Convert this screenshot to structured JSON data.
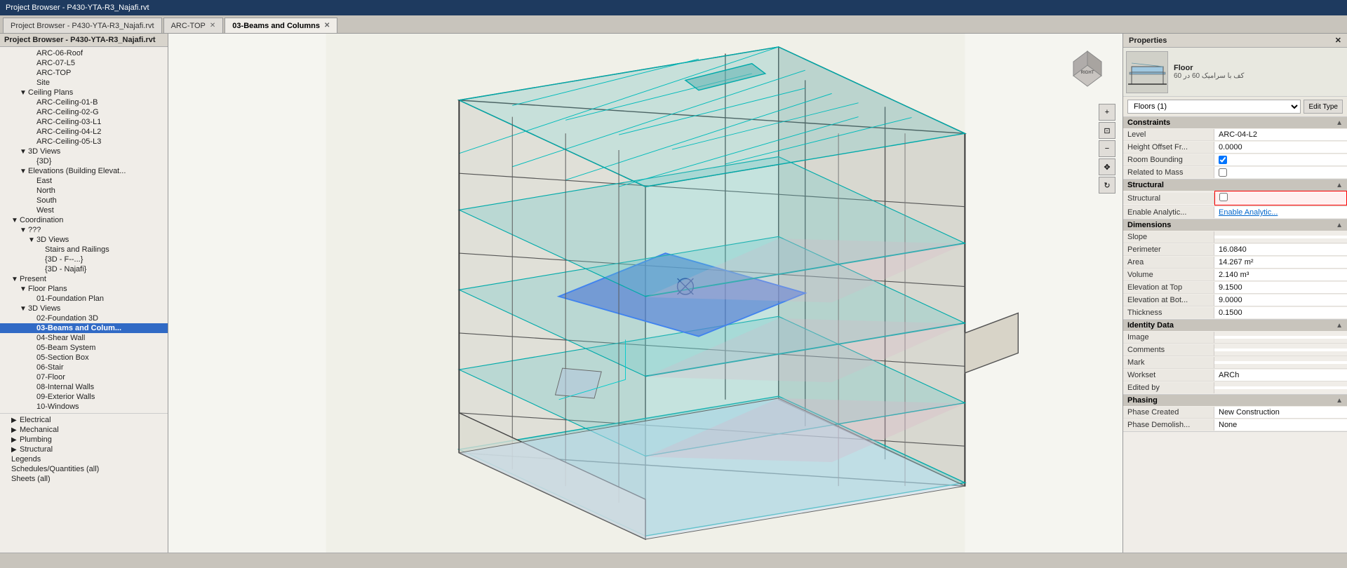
{
  "titleBar": {
    "text": "Project Browser - P430-YTA-R3_Najafi.rvt"
  },
  "tabs": [
    {
      "id": "project-browser",
      "label": "Project Browser - P430-YTA-R3_Najafi.rvt",
      "active": false,
      "closable": false
    },
    {
      "id": "arc-top",
      "label": "ARC-TOP",
      "active": false,
      "closable": true
    },
    {
      "id": "beams-columns",
      "label": "03-Beams and Columns",
      "active": true,
      "closable": true
    }
  ],
  "projectBrowser": {
    "title": "Project Browser - P430-YTA-R3_Najafi.rvt",
    "tree": [
      {
        "id": "arc-06-roof",
        "label": "ARC-06-Roof",
        "indent": 3,
        "toggle": "",
        "selected": false
      },
      {
        "id": "arc-07-l5",
        "label": "ARC-07-L5",
        "indent": 3,
        "toggle": "",
        "selected": false
      },
      {
        "id": "arc-top",
        "label": "ARC-TOP",
        "indent": 3,
        "toggle": "",
        "selected": false
      },
      {
        "id": "site",
        "label": "Site",
        "indent": 3,
        "toggle": "",
        "selected": false
      },
      {
        "id": "ceiling-plans",
        "label": "Ceiling Plans",
        "indent": 2,
        "toggle": "▼",
        "selected": false
      },
      {
        "id": "arc-ceiling-01-b",
        "label": "ARC-Ceiling-01-B",
        "indent": 3,
        "toggle": "",
        "selected": false
      },
      {
        "id": "arc-ceiling-02-g",
        "label": "ARC-Ceiling-02-G",
        "indent": 3,
        "toggle": "",
        "selected": false
      },
      {
        "id": "arc-ceiling-03-l1",
        "label": "ARC-Ceiling-03-L1",
        "indent": 3,
        "toggle": "",
        "selected": false
      },
      {
        "id": "arc-ceiling-04-l2",
        "label": "ARC-Ceiling-04-L2",
        "indent": 3,
        "toggle": "",
        "selected": false
      },
      {
        "id": "arc-ceiling-05-l3",
        "label": "ARC-Ceiling-05-L3",
        "indent": 3,
        "toggle": "",
        "selected": false
      },
      {
        "id": "3d-views-arc",
        "label": "3D Views",
        "indent": 2,
        "toggle": "▼",
        "selected": false
      },
      {
        "id": "3d",
        "label": "{3D}",
        "indent": 3,
        "toggle": "",
        "selected": false
      },
      {
        "id": "elevations",
        "label": "Elevations (Building Elevat...",
        "indent": 2,
        "toggle": "▼",
        "selected": false
      },
      {
        "id": "east",
        "label": "East",
        "indent": 3,
        "toggle": "",
        "selected": false
      },
      {
        "id": "north",
        "label": "North",
        "indent": 3,
        "toggle": "",
        "selected": false
      },
      {
        "id": "south",
        "label": "South",
        "indent": 3,
        "toggle": "",
        "selected": false
      },
      {
        "id": "west",
        "label": "West",
        "indent": 3,
        "toggle": "",
        "selected": false
      },
      {
        "id": "coordination",
        "label": "Coordination",
        "indent": 1,
        "toggle": "▼",
        "selected": false
      },
      {
        "id": "qqq",
        "label": "???",
        "indent": 2,
        "toggle": "▼",
        "selected": false
      },
      {
        "id": "3d-views-coord",
        "label": "3D Views",
        "indent": 3,
        "toggle": "▼",
        "selected": false
      },
      {
        "id": "stairs-railings",
        "label": "Stairs and Railings",
        "indent": 4,
        "toggle": "",
        "selected": false
      },
      {
        "id": "3d-f",
        "label": "{3D - F--...}",
        "indent": 4,
        "toggle": "",
        "selected": false
      },
      {
        "id": "3d-najafi",
        "label": "{3D - Najafi}",
        "indent": 4,
        "toggle": "",
        "selected": false
      },
      {
        "id": "present",
        "label": "Present",
        "indent": 1,
        "toggle": "▼",
        "selected": false
      },
      {
        "id": "floor-plans",
        "label": "Floor Plans",
        "indent": 2,
        "toggle": "▼",
        "selected": false
      },
      {
        "id": "01-foundation-plan",
        "label": "01-Foundation Plan",
        "indent": 3,
        "toggle": "",
        "selected": false
      },
      {
        "id": "3d-views-present",
        "label": "3D Views",
        "indent": 2,
        "toggle": "▼",
        "selected": false
      },
      {
        "id": "02-foundation-3d",
        "label": "02-Foundation 3D",
        "indent": 3,
        "toggle": "",
        "selected": false
      },
      {
        "id": "03-beams-colum",
        "label": "03-Beams and Colum...",
        "indent": 3,
        "toggle": "",
        "selected": true
      },
      {
        "id": "04-shear-wall",
        "label": "04-Shear Wall",
        "indent": 3,
        "toggle": "",
        "selected": false
      },
      {
        "id": "05-beam-system",
        "label": "05-Beam System",
        "indent": 3,
        "toggle": "",
        "selected": false
      },
      {
        "id": "05-section-box",
        "label": "05-Section Box",
        "indent": 3,
        "toggle": "",
        "selected": false
      },
      {
        "id": "06-stair",
        "label": "06-Stair",
        "indent": 3,
        "toggle": "",
        "selected": false
      },
      {
        "id": "07-floor",
        "label": "07-Floor",
        "indent": 3,
        "toggle": "",
        "selected": false
      },
      {
        "id": "08-internal-walls",
        "label": "08-Internal Walls",
        "indent": 3,
        "toggle": "",
        "selected": false
      },
      {
        "id": "09-exterior-walls",
        "label": "09-Exterior Walls",
        "indent": 3,
        "toggle": "",
        "selected": false
      },
      {
        "id": "10-windows",
        "label": "10-Windows",
        "indent": 3,
        "toggle": "",
        "selected": false
      }
    ],
    "bottomItems": [
      {
        "id": "electrical",
        "label": "Electrical",
        "indent": 1,
        "toggle": "▶",
        "selected": false
      },
      {
        "id": "mechanical",
        "label": "Mechanical",
        "indent": 1,
        "toggle": "▶",
        "selected": false
      },
      {
        "id": "plumbing",
        "label": "Plumbing",
        "indent": 1,
        "toggle": "▶",
        "selected": false
      },
      {
        "id": "structural",
        "label": "Structural",
        "indent": 1,
        "toggle": "▶",
        "selected": false
      },
      {
        "id": "legends",
        "label": "Legends",
        "indent": 0,
        "toggle": "",
        "selected": false
      },
      {
        "id": "schedules",
        "label": "Schedules/Quantities (all)",
        "indent": 0,
        "toggle": "",
        "selected": false
      },
      {
        "id": "sheets",
        "label": "Sheets (all)",
        "indent": 0,
        "toggle": "",
        "selected": false
      }
    ]
  },
  "properties": {
    "title": "Properties",
    "previewLabel": "Floor",
    "previewSubtitle": "کف با سرامیک 60 در 60",
    "dropdownOptions": [
      "Floors (1)"
    ],
    "dropdownSelected": "Floors (1)",
    "editTypeLabel": "Edit Type",
    "sections": [
      {
        "id": "constraints",
        "title": "Constraints",
        "collapsed": false,
        "rows": [
          {
            "label": "Level",
            "value": "ARC-04-L2",
            "type": "text"
          },
          {
            "label": "Height Offset Fr...",
            "value": "0.0000",
            "type": "text"
          },
          {
            "label": "Room Bounding",
            "value": "",
            "type": "checkbox",
            "checked": true
          },
          {
            "label": "Related to Mass",
            "value": "",
            "type": "checkbox",
            "checked": false
          }
        ]
      },
      {
        "id": "structural",
        "title": "Structural",
        "collapsed": false,
        "rows": [
          {
            "label": "Structural",
            "value": "",
            "type": "checkbox-red",
            "checked": false
          },
          {
            "label": "Enable Analytic...",
            "value": "",
            "type": "link"
          }
        ]
      },
      {
        "id": "dimensions",
        "title": "Dimensions",
        "collapsed": false,
        "rows": [
          {
            "label": "Slope",
            "value": "",
            "type": "text"
          },
          {
            "label": "Perimeter",
            "value": "16.0840",
            "type": "text"
          },
          {
            "label": "Area",
            "value": "14.267 m²",
            "type": "text"
          },
          {
            "label": "Volume",
            "value": "2.140 m³",
            "type": "text"
          },
          {
            "label": "Elevation at Top",
            "value": "9.1500",
            "type": "text"
          },
          {
            "label": "Elevation at Bot...",
            "value": "9.0000",
            "type": "text"
          },
          {
            "label": "Thickness",
            "value": "0.1500",
            "type": "text"
          }
        ]
      },
      {
        "id": "identity-data",
        "title": "Identity Data",
        "collapsed": false,
        "rows": [
          {
            "label": "Image",
            "value": "",
            "type": "text"
          },
          {
            "label": "Comments",
            "value": "",
            "type": "text"
          },
          {
            "label": "Mark",
            "value": "",
            "type": "text"
          },
          {
            "label": "Workset",
            "value": "ARCh",
            "type": "text"
          },
          {
            "label": "Edited by",
            "value": "",
            "type": "text"
          }
        ]
      },
      {
        "id": "phasing",
        "title": "Phasing",
        "collapsed": false,
        "rows": [
          {
            "label": "Phase Created",
            "value": "New Construction",
            "type": "text"
          },
          {
            "label": "Phase Demolish...",
            "value": "None",
            "type": "text"
          }
        ]
      }
    ]
  },
  "navCube": {
    "rightLabel": "RIGHT"
  },
  "statusBar": {
    "text": ""
  }
}
